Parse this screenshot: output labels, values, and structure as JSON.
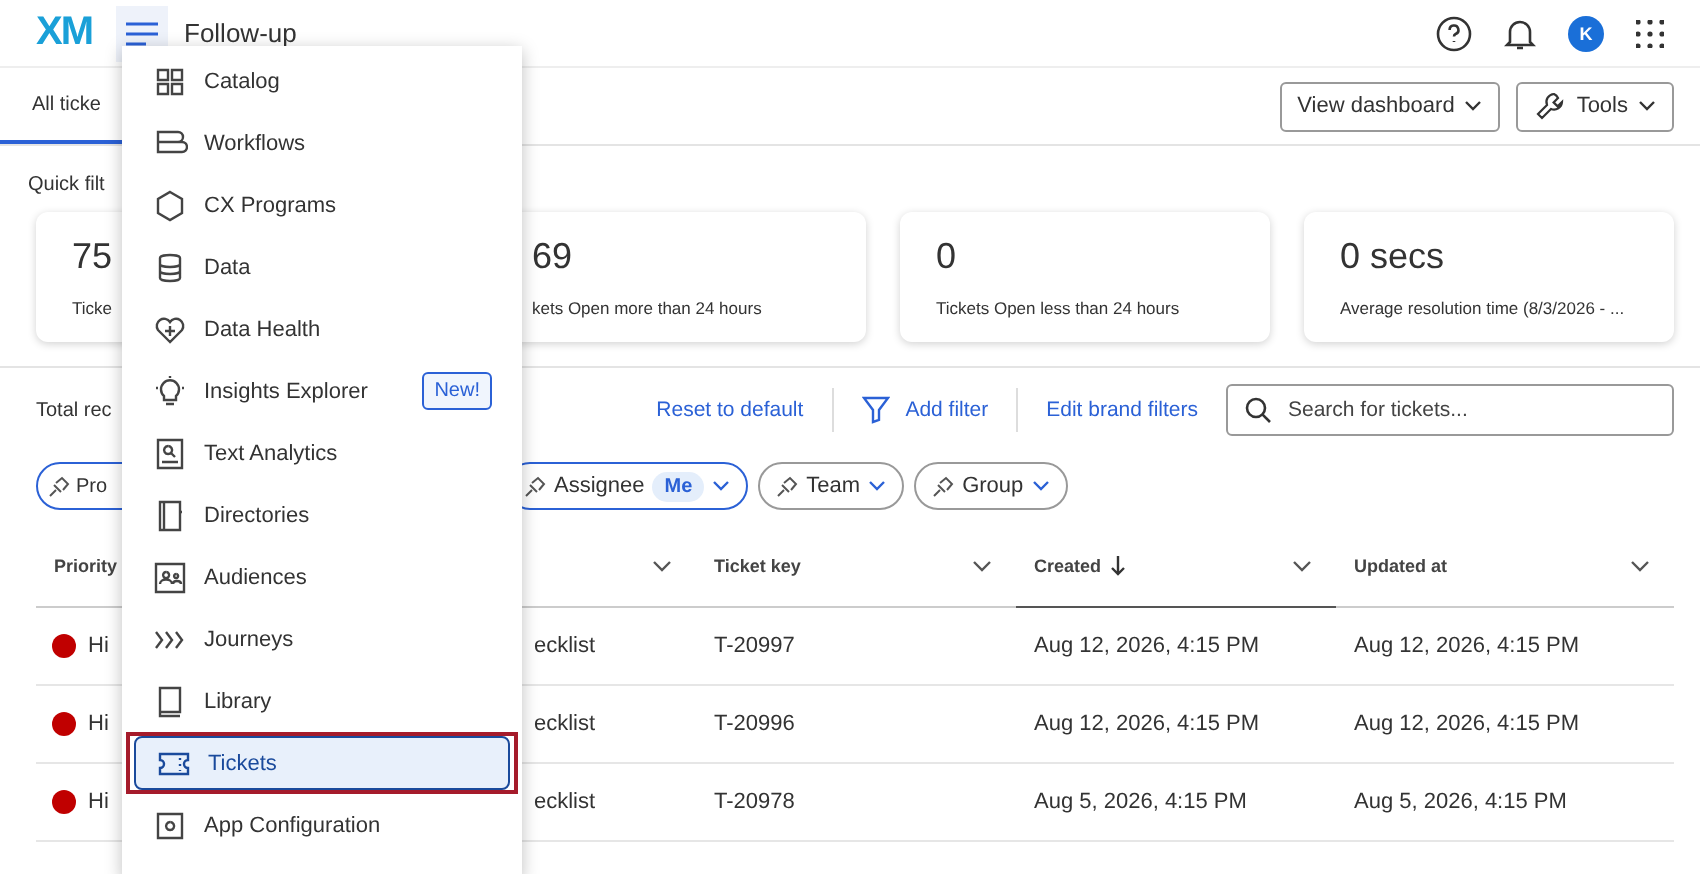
{
  "top_bar": {
    "logo": "XM",
    "title": "Follow-up",
    "avatar": "K"
  },
  "tabs": [
    {
      "label": "All ticke",
      "selected": true
    }
  ],
  "header_buttons": [
    "View dashboard",
    "Tools"
  ],
  "quick_filters": {
    "label": "Quick filt"
  },
  "stats": [
    {
      "value": "75",
      "label": "Ticke"
    },
    {
      "value": "69",
      "label": "kets Open more than 24 hours"
    },
    {
      "value": "0",
      "label": "Tickets Open less than 24 hours"
    },
    {
      "value": "0 secs",
      "label": "Average resolution time (8/3/2026 - ..."
    }
  ],
  "toolbar": {
    "total": "Total rec",
    "reset": "Reset to default",
    "add_filter": "Add filter",
    "edit_brand": "Edit brand filters",
    "search_placeholder": "Search for tickets..."
  },
  "chips": [
    {
      "label": "Pro"
    },
    {
      "label": "Assignee",
      "badge": "Me"
    },
    {
      "label": "Team"
    },
    {
      "label": "Group"
    }
  ],
  "table": {
    "columns": [
      {
        "label": "Priority",
        "sorted": false
      },
      {
        "sorted": false
      },
      {
        "label": "Ticket key",
        "sorted": false
      },
      {
        "label": "Created",
        "sorted": true
      },
      {
        "label": "Updated at",
        "sorted": false
      }
    ],
    "rows": [
      {
        "priority": "Hi",
        "color": "#c00000",
        "name": "ecklist",
        "key": "T-20997",
        "created": "Aug 12, 2026, 4:15 PM",
        "updated": "Aug 12, 2026, 4:15 PM"
      },
      {
        "priority": "Hi",
        "color": "#c00000",
        "name": "ecklist",
        "key": "T-20996",
        "created": "Aug 12, 2026, 4:15 PM",
        "updated": "Aug 12, 2026, 4:15 PM"
      },
      {
        "priority": "Hi",
        "color": "#c00000",
        "name": "ecklist",
        "key": "T-20978",
        "created": "Aug 5, 2026, 4:15 PM",
        "updated": "Aug 5, 2026, 4:15 PM"
      }
    ]
  },
  "menu": {
    "items": [
      {
        "label": "Catalog",
        "selected": false
      },
      {
        "label": "Workflows",
        "selected": false
      },
      {
        "label": "CX Programs",
        "selected": false
      },
      {
        "label": "Data",
        "selected": false
      },
      {
        "label": "Data Health",
        "selected": false
      },
      {
        "label": "Insights Explorer",
        "badge": "New!",
        "selected": false
      },
      {
        "label": "Text Analytics",
        "selected": false
      },
      {
        "label": "Directories",
        "selected": false
      },
      {
        "label": "Audiences",
        "selected": false
      },
      {
        "label": "Journeys",
        "selected": false
      },
      {
        "label": "Library",
        "selected": false
      },
      {
        "label": "Tickets",
        "selected": true,
        "annotated": true
      },
      {
        "label": "App Configuration",
        "selected": false
      }
    ]
  }
}
